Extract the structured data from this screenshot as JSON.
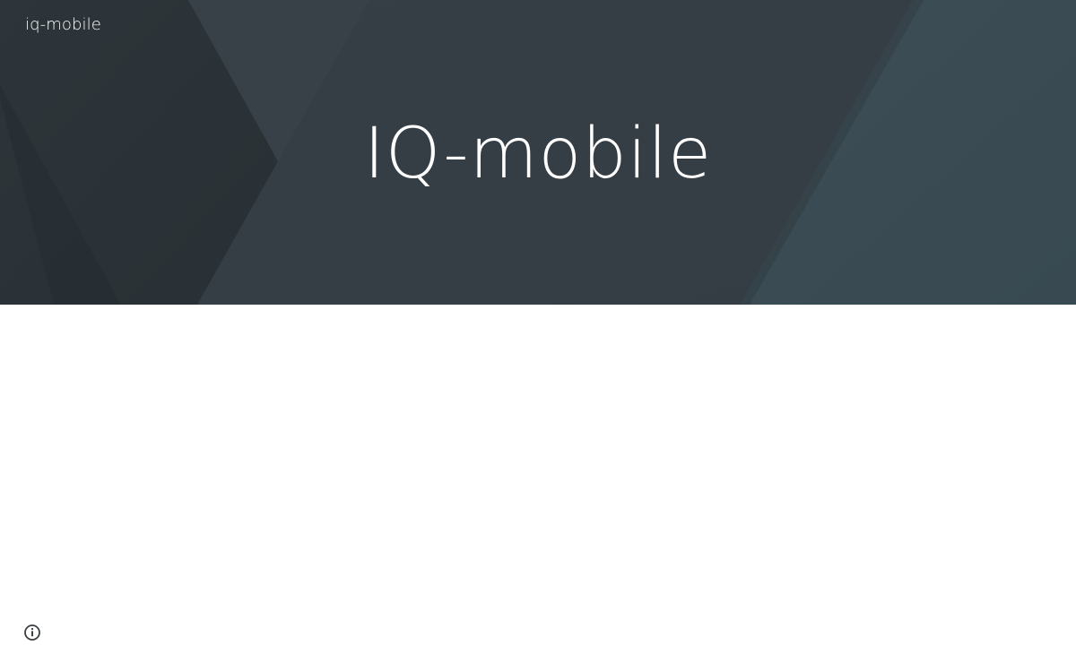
{
  "header": {
    "site_name": "iq-mobile"
  },
  "hero": {
    "title": "IQ-mobile",
    "colors": {
      "base": "#323c42",
      "dark_panel": "#2a3136",
      "teal_panel": "#3a4b53",
      "title_text": "#ffffff"
    }
  },
  "footer": {
    "info_icon": "info-icon"
  }
}
